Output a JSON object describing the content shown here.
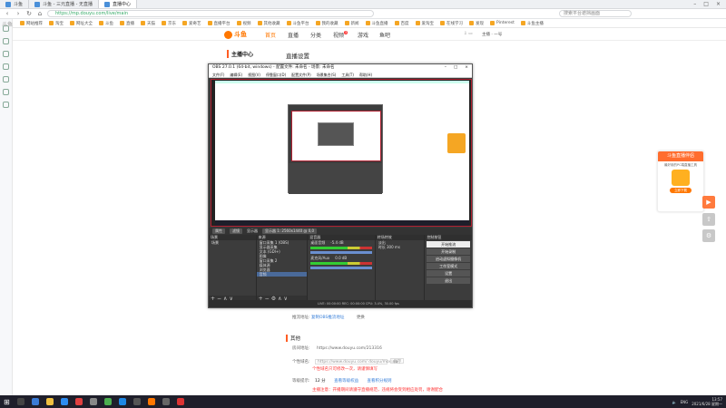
{
  "browser": {
    "tabs": [
      {
        "label": "斗鱼",
        "active": false
      },
      {
        "label": "斗鱼 - 三元直播 - 无直播",
        "active": false
      },
      {
        "label": "直播中心",
        "active": true
      }
    ],
    "url": "https://mp.douyu.com/live/main",
    "search_placeholder": "搜索平台遮挡画面",
    "bookmarks": [
      "网站推荐",
      "淘宝",
      "网址大全",
      "斗鱼",
      "直播",
      "天猫",
      "京东",
      "爱奇艺",
      "直播平台",
      "视频",
      "其他收藏",
      "斗鱼平台",
      "我的收藏",
      "新闻",
      "斗鱼直播",
      "百度",
      "爱淘宝",
      "在线学习",
      "发现",
      "Pinterest",
      "斗鱼主播"
    ]
  },
  "site": {
    "logo": "斗鱼",
    "nav": [
      "首页",
      "直播",
      "分类",
      "视频",
      "游戏",
      "鱼吧"
    ],
    "video_badge": "3",
    "user": "主播 · 一号"
  },
  "menu": {
    "title": "主播中心"
  },
  "content": {
    "title": "直播设置",
    "below_obs_label": "推流地址:",
    "below_obs_link": "复制OBS推流地址",
    "below_obs_extra": "更换",
    "section_other": "其他",
    "room_label": "房间地址:",
    "room_url": "https://www.douyu.com/213316",
    "domain_label": "个性域名:",
    "domain_input": "https://www.douyu.com/ douyu/moving",
    "domain_btn": "保存",
    "domain_warn": "个性域名只可修改一次，请谨慎填写",
    "level_label": "等级提示:",
    "level_value": "12 分",
    "level_link1": "查看等级权益",
    "level_link2": "查看积分规则",
    "footer_warn": "主播注意：开播期间请遵守直播规范，违规将会受到相应处罚，谢谢配合"
  },
  "obs": {
    "title": "OBS 27.0.1 (64-bit, windows) - 配置文件: 未命名 - 场景: 未命名",
    "menu": [
      "文件(F)",
      "编辑(E)",
      "视图(V)",
      "停靠窗口(D)",
      "配置文件(P)",
      "场景集合(S)",
      "工具(T)",
      "帮助(H)"
    ],
    "toolbar": [
      "属性",
      "滤镜",
      "显示器",
      "显示器 1: 2560x1440 @ 0,0"
    ],
    "scenes_title": "场景",
    "scenes": [
      "场景"
    ],
    "sources_title": "来源",
    "sources": [
      "窗口采集 1 (OBS)",
      "显示器采集",
      "文本 (GDI+)",
      "图像",
      "窗口采集 2",
      "媒体源",
      "浏览器",
      "音频"
    ],
    "mixer_title": "混音器",
    "mixer": [
      {
        "name": "桌面音频",
        "db": "-5.4 dB"
      },
      {
        "name": "麦克风/Aux",
        "db": "0.0 dB"
      }
    ],
    "transition_title": "转场特效",
    "transition": {
      "type": "淡出",
      "duration_label": "时长",
      "duration": "300 ms"
    },
    "controls_title": "控制按钮",
    "controls": [
      "开始推流",
      "开始录制",
      "启动虚拟摄像机",
      "工作室模式",
      "设置",
      "退出"
    ],
    "status": "LIVE: 00:00:00   REC: 00:00:00   CPU: 3.4%, 30.00 fps"
  },
  "promo": {
    "title": "斗鱼直播伴侣",
    "desc": "最好用的PC端直播工具",
    "button": "立即下载"
  },
  "taskbar": {
    "tray_lang": "ENG",
    "time": "13:57",
    "date": "2021/6/28 星期一"
  },
  "watermark": "斗鱼"
}
